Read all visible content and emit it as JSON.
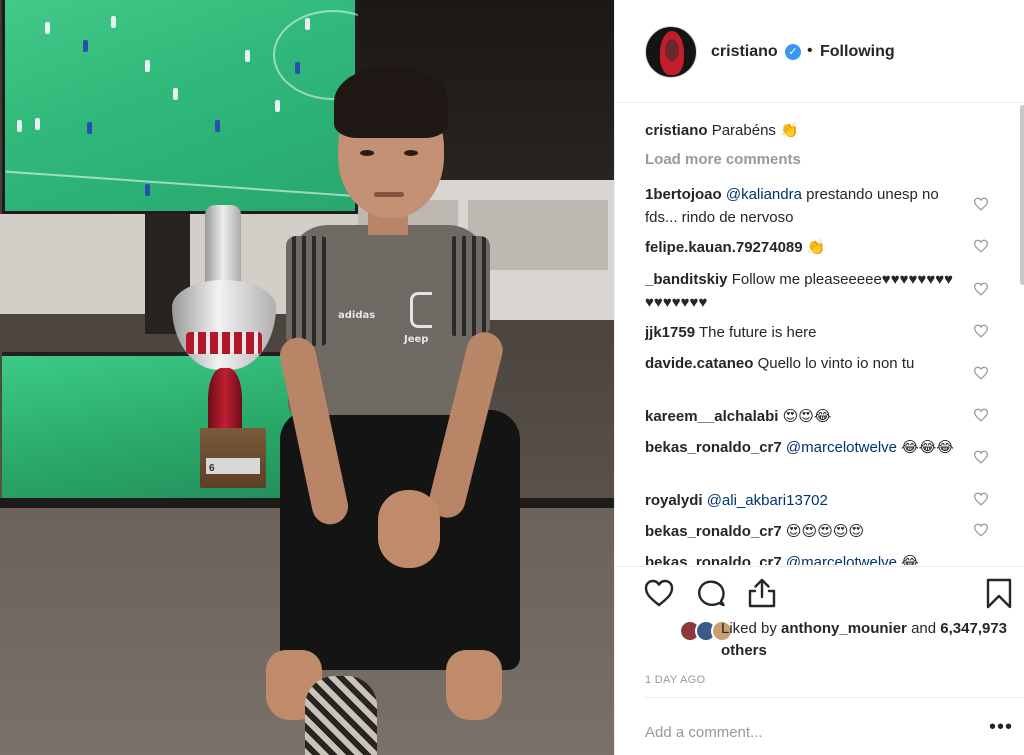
{
  "post": {
    "username": "cristiano",
    "verified_badge": "✓",
    "separator": "•",
    "follow_status": "Following"
  },
  "photo": {
    "trophy_plate_text": "6",
    "shirt_brand": "adidas",
    "shirt_sponsor": "Jeep",
    "crest_letter": "J"
  },
  "comments": {
    "caption": {
      "user": "cristiano",
      "text": "Parabéns 👏"
    },
    "load_more": "Load more comments",
    "items": [
      {
        "user": "1bertojoao",
        "mention": "@kaliandra",
        "text": " prestando unesp no fds... rindo de nervoso"
      },
      {
        "user": "felipe.kauan.79274089",
        "mention": "",
        "text": "👏"
      },
      {
        "user": "_banditskiy",
        "mention": "",
        "text": "Follow me pleaseeeee♥♥♥♥♥♥♥♥♥♥♥♥♥♥♥"
      },
      {
        "user": "jjk1759",
        "mention": "",
        "text": "The future is here"
      },
      {
        "user": "davide.cataneo",
        "mention": "",
        "text": "Quello lo vinto io non tu"
      },
      {
        "user": "kareem__alchalabi",
        "mention": "",
        "text": "😍😍😂"
      },
      {
        "user": "bekas_ronaldo_cr7",
        "mention": "@marcelotwelve",
        "text": " 😂😂😂"
      },
      {
        "user": "royalydi",
        "mention": "@ali_akbari13702",
        "text": ""
      },
      {
        "user": "bekas_ronaldo_cr7",
        "mention": "",
        "text": "😍😍😍😍😍"
      },
      {
        "user": "bekas_ronaldo_cr7",
        "mention": "@marcelotwelve",
        "text": " 😂"
      }
    ]
  },
  "likes": {
    "prefix": "Liked by ",
    "user": "anthony_mounier",
    "middle": " and ",
    "count": "6,347,973 others"
  },
  "timestamp": "1 DAY AGO",
  "add_comment": {
    "placeholder": "Add a comment..."
  },
  "more_options": "•••",
  "icons": [
    "heart-icon",
    "comment-icon",
    "share-icon",
    "bookmark-icon",
    "more-options-icon",
    "verified-icon"
  ],
  "colors": {
    "accent": "#3897f0",
    "mention": "#003569",
    "muted": "#999999",
    "border": "#efefef"
  }
}
